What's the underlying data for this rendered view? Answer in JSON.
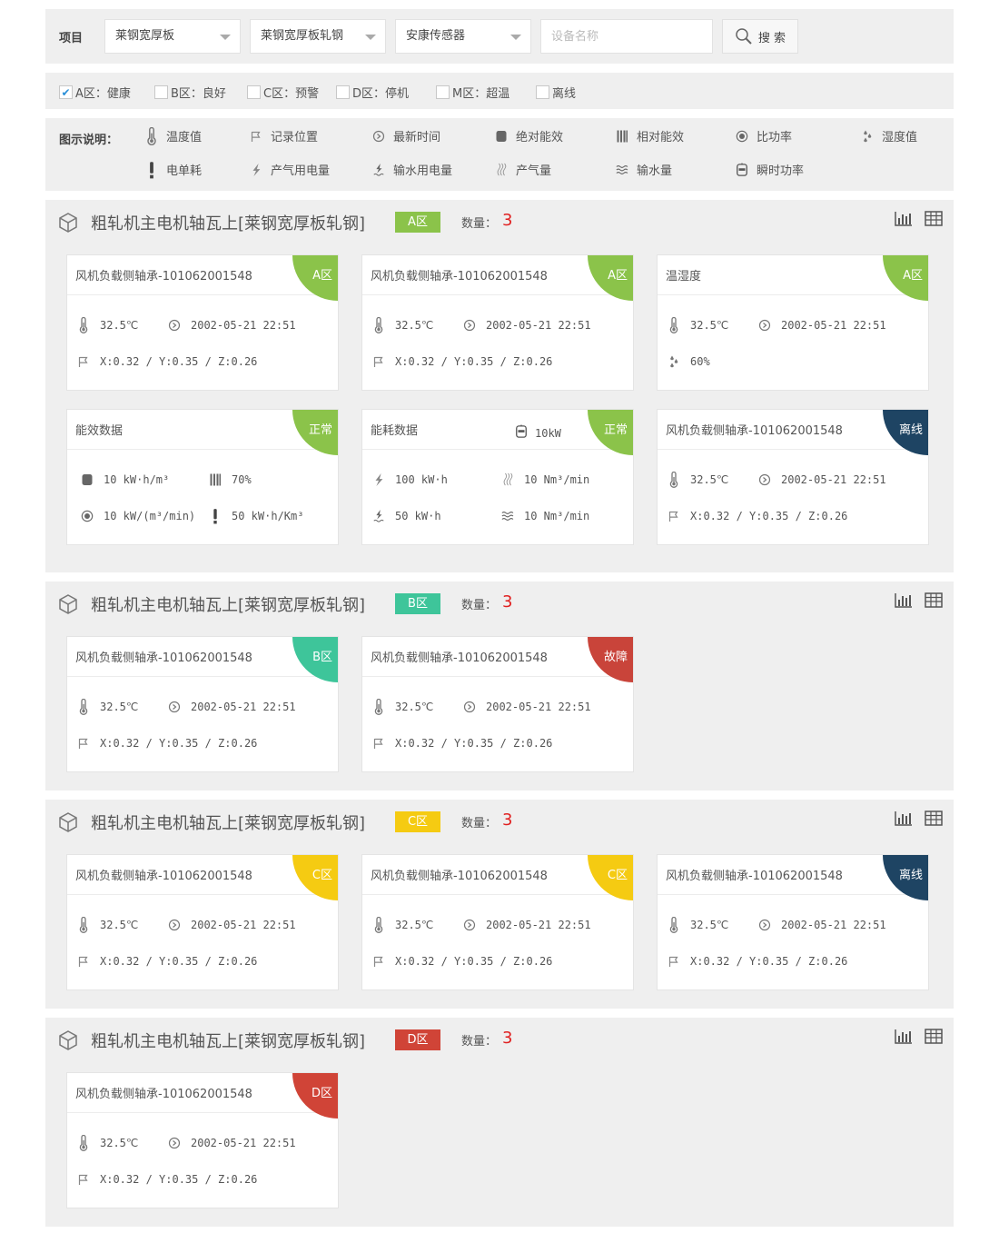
{
  "filter": {
    "label": "项目",
    "selects": [
      {
        "value": "莱钢宽厚板"
      },
      {
        "value": "莱钢宽厚板轧钢"
      },
      {
        "value": "安康传感器"
      }
    ],
    "device_placeholder": "设备名称",
    "search_label": "搜 索"
  },
  "status_filter": [
    {
      "label": "A区：健康",
      "checked": true
    },
    {
      "label": "B区：良好",
      "checked": false
    },
    {
      "label": "C区：预警",
      "checked": false
    },
    {
      "label": "D区：停机",
      "checked": false
    },
    {
      "label": "M区：超温",
      "checked": false
    },
    {
      "label": "离线",
      "checked": false
    }
  ],
  "legend": {
    "title": "图示说明：",
    "items": [
      {
        "icon": "thermometer-icon",
        "label": "温度值"
      },
      {
        "icon": "flag-icon",
        "label": "记录位置"
      },
      {
        "icon": "clock-icon",
        "label": "最新时间"
      },
      {
        "icon": "cylinder-icon",
        "label": "绝对能效"
      },
      {
        "icon": "bars-icon",
        "label": "相对能效"
      },
      {
        "icon": "target-icon",
        "label": "比功率"
      },
      {
        "icon": "droplets-icon",
        "label": "湿度值"
      },
      {
        "icon": "exclamation-icon",
        "label": "电单耗"
      },
      {
        "icon": "lightning-icon",
        "label": "产气用电量"
      },
      {
        "icon": "water-lightning-icon",
        "label": "输水用电量"
      },
      {
        "icon": "steam-icon",
        "label": "产气量"
      },
      {
        "icon": "waves-icon",
        "label": "输水量"
      },
      {
        "icon": "meter-icon",
        "label": "瞬时功率"
      }
    ]
  },
  "colors": {
    "A": "#8bc34a",
    "B": "#3ec59a",
    "C": "#f5cb12",
    "D": "#d04437",
    "fault": "#c9443a",
    "offline": "#1e4463"
  },
  "groups": [
    {
      "title": "粗轧机主电机轴瓦上[莱钢宽厚板轧钢]",
      "zone": "A区",
      "count_label": "数量：",
      "count": "3",
      "cards": [
        {
          "title": "风机负载侧轴承-101062001548",
          "badge": "A区",
          "temp": "32.5℃",
          "time": "2002-05-21 22:51",
          "pos": "X:0.32 / Y:0.35 / Z:0.26"
        },
        {
          "title": "风机负载侧轴承-101062001548",
          "badge": "A区",
          "temp": "32.5℃",
          "time": "2002-05-21 22:51",
          "pos": "X:0.32 / Y:0.35 / Z:0.26"
        },
        {
          "title": "温湿度",
          "badge": "A区",
          "temp": "32.5℃",
          "time": "2002-05-21 22:51",
          "humidity": "60%"
        },
        {
          "title": "能效数据",
          "badge": "正常",
          "abs_eff": "10 kW·h/m³",
          "rel_eff": "70%",
          "specific_power": "10 kW/(m³/min)",
          "unit_consumption": "50 kW·h/Km³"
        },
        {
          "title": "能耗数据",
          "badge": "正常",
          "power": "10kW",
          "gas_power": "100 kW·h",
          "gas_volume": "10 Nm³/min",
          "water_power": "50 kW·h",
          "water_volume": "10 Nm³/min"
        },
        {
          "title": "风机负载侧轴承-101062001548",
          "badge": "离线",
          "temp": "32.5℃",
          "time": "2002-05-21 22:51",
          "pos": "X:0.32 / Y:0.35 / Z:0.26"
        }
      ]
    },
    {
      "title": "粗轧机主电机轴瓦上[莱钢宽厚板轧钢]",
      "zone": "B区",
      "count_label": "数量：",
      "count": "3",
      "cards": [
        {
          "title": "风机负载侧轴承-101062001548",
          "badge": "B区",
          "temp": "32.5℃",
          "time": "2002-05-21 22:51",
          "pos": "X:0.32 / Y:0.35 / Z:0.26"
        },
        {
          "title": "风机负载侧轴承-101062001548",
          "badge": "故障",
          "temp": "32.5℃",
          "time": "2002-05-21 22:51",
          "pos": "X:0.32 / Y:0.35 / Z:0.26"
        }
      ]
    },
    {
      "title": "粗轧机主电机轴瓦上[莱钢宽厚板轧钢]",
      "zone": "C区",
      "count_label": "数量：",
      "count": "3",
      "cards": [
        {
          "title": "风机负载侧轴承-101062001548",
          "badge": "C区",
          "temp": "32.5℃",
          "time": "2002-05-21 22:51",
          "pos": "X:0.32 / Y:0.35 / Z:0.26"
        },
        {
          "title": "风机负载侧轴承-101062001548",
          "badge": "C区",
          "temp": "32.5℃",
          "time": "2002-05-21 22:51",
          "pos": "X:0.32 / Y:0.35 / Z:0.26"
        },
        {
          "title": "风机负载侧轴承-101062001548",
          "badge": "离线",
          "temp": "32.5℃",
          "time": "2002-05-21 22:51",
          "pos": "X:0.32 / Y:0.35 / Z:0.26"
        }
      ]
    },
    {
      "title": "粗轧机主电机轴瓦上[莱钢宽厚板轧钢]",
      "zone": "D区",
      "count_label": "数量：",
      "count": "3",
      "cards": [
        {
          "title": "风机负载侧轴承-101062001548",
          "badge": "D区",
          "temp": "32.5℃",
          "time": "2002-05-21 22:51",
          "pos": "X:0.32 / Y:0.35 / Z:0.26"
        }
      ]
    }
  ]
}
